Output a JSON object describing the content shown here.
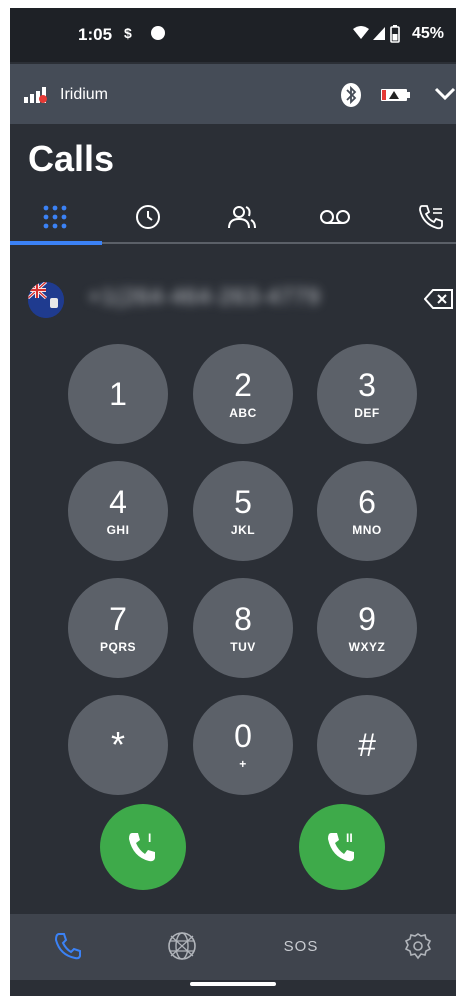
{
  "status_bar": {
    "time": "1:05",
    "battery": "45%"
  },
  "iridium_bar": {
    "network_name": "Iridium"
  },
  "page": {
    "title": "Calls"
  },
  "tabs": [
    {
      "icon": "dialpad-icon",
      "active": true
    },
    {
      "icon": "clock-icon",
      "active": false
    },
    {
      "icon": "contacts-icon",
      "active": false
    },
    {
      "icon": "voicemail-icon",
      "active": false
    },
    {
      "icon": "call-log-icon",
      "active": false
    }
  ],
  "dialer": {
    "number": "+1(264-464-263-4779"
  },
  "keypad": [
    {
      "digit": "1",
      "letters": ""
    },
    {
      "digit": "2",
      "letters": "ABC"
    },
    {
      "digit": "3",
      "letters": "DEF"
    },
    {
      "digit": "4",
      "letters": "GHI"
    },
    {
      "digit": "5",
      "letters": "JKL"
    },
    {
      "digit": "6",
      "letters": "MNO"
    },
    {
      "digit": "7",
      "letters": "PQRS"
    },
    {
      "digit": "8",
      "letters": "TUV"
    },
    {
      "digit": "9",
      "letters": "WXYZ"
    },
    {
      "digit": "*",
      "letters": ""
    },
    {
      "digit": "0",
      "letters": "+"
    },
    {
      "digit": "#",
      "letters": ""
    }
  ],
  "call_buttons": {
    "line1_label": "I",
    "line2_label": "II",
    "color": "#3eaa4a"
  },
  "bottom_nav": {
    "sos_label": "SOS",
    "active_color": "#3b82f6"
  }
}
